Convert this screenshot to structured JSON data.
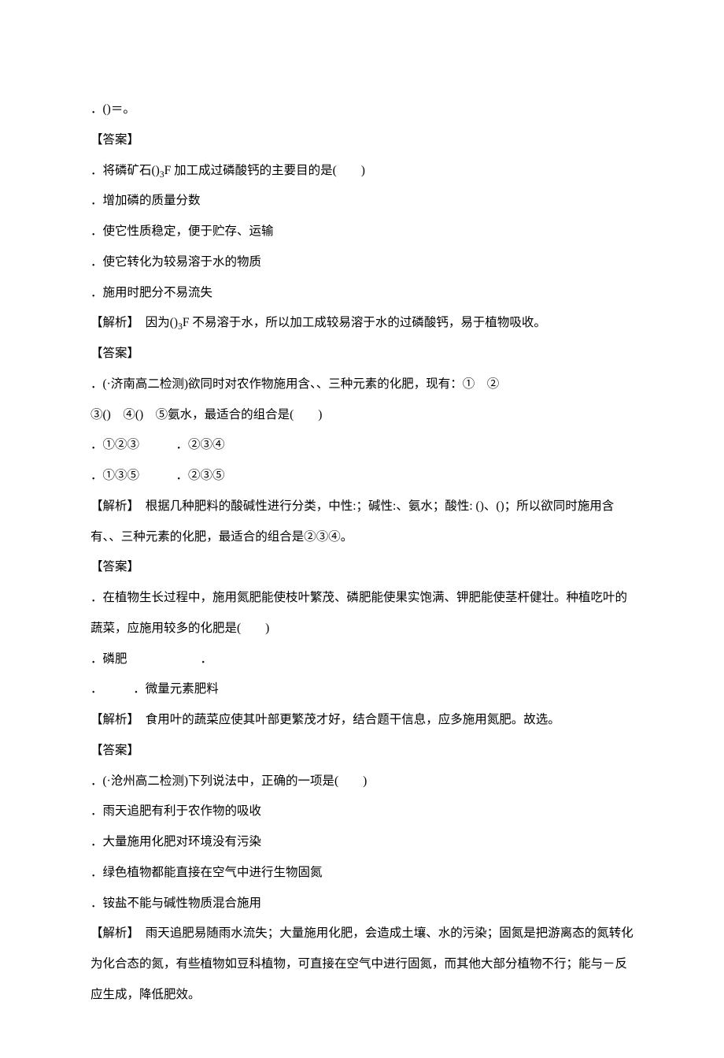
{
  "lines": [
    "．()＝。",
    "【答案】",
    "．将磷矿石()₃F 加工成过磷酸钙的主要目的是(　　)",
    "．增加磷的质量分数",
    "．使它性质稳定，便于贮存、运输",
    "．使它转化为较易溶于水的物质",
    "．施用时肥分不易流失",
    "【解析】　因为()₃F 不易溶于水，所以加工成较易溶于水的过磷酸钙，易于植物吸收。",
    "【答案】",
    "．(·济南高二检测)欲同时对农作物施用含、、三种元素的化肥，现有：①　②",
    "③()　④()　⑤氨水，最适合的组合是(　　)",
    "．①②③　　　．②③④",
    "．①③⑤　　　．②③⑤",
    "【解析】　根据几种肥料的酸碱性进行分类，中性:；碱性:、氨水；酸性: ()、()；所以欲同时施用含有、、三种元素的化肥，最适合的组合是②③④。",
    "【答案】",
    "．在植物生长过程中，施用氮肥能使枝叶繁茂、磷肥能使果实饱满、钾肥能使茎杆健壮。种植吃叶的蔬菜，应施用较多的化肥是(　　)",
    "．磷肥　　　　　　．",
    "．　　　．微量元素肥料",
    "【解析】　食用叶的蔬菜应使其叶部更繁茂才好，结合题干信息，应多施用氮肥。故选。",
    "【答案】",
    "．(·沧州高二检测)下列说法中，正确的一项是(　　)",
    "．雨天追肥有利于农作物的吸收",
    "．大量施用化肥对环境没有污染",
    "．绿色植物都能直接在空气中进行生物固氮",
    "．铵盐不能与碱性物质混合施用",
    "【解析】　雨天追肥易随雨水流失；大量施用化肥，会造成土壤、水的污染；固氮是把游离态的氮转化为化合态的氮，有些植物如豆科植物，可直接在空气中进行固氮，而其他大部分植物不行；能与－反应生成，降低肥效。"
  ]
}
